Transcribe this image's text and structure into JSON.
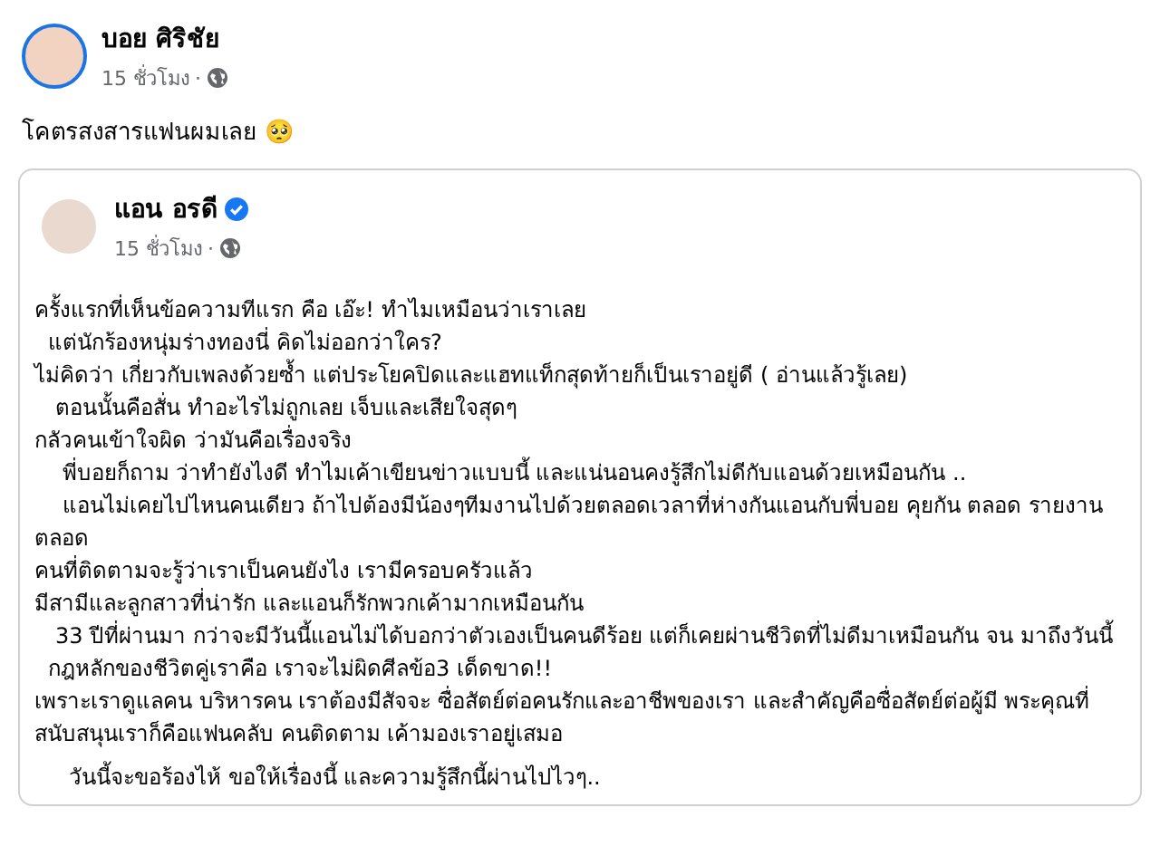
{
  "post": {
    "author": "บอย ศิริชัย",
    "time": "15 ชั่วโมง",
    "separator": "·",
    "text": "โคตรสงสารแฟนผมเลย 🥺"
  },
  "shared_post": {
    "author": "แอน อรดี",
    "verified": true,
    "time": "15 ชั่วโมง",
    "separator": "·",
    "paragraphs": [
      "ครั้งแรกที่เห็นข้อความทีแรก คือ เอ๊ะ! ทำไมเหมือนว่าเราเลย",
      "  แต่นักร้องหนุ่มร่างทองนี่ คิดไม่ออกว่าใคร?",
      "ไม่คิดว่า เกี่ยวกับเพลงด้วยซ้ำ แต่ประโยคปิดและแฮทแท็กสุดท้ายก็เป็นเราอยู่ดี ( อ่านแล้วรู้เลย)",
      "   ตอนนั้นคือสั่น ทำอะไรไม่ถูกเลย เจ็บและเสียใจสุดๆ",
      "กลัวคนเข้าใจผิด ว่ามันคือเรื่องจริง",
      "    พี่บอยก็ถาม ว่าทำยังไงดี ทำไมเค้าเขียนข่าวแบบนี้ และแน่นอนคงรู้สึกไม่ดีกับแอนด้วยเหมือนกัน ..",
      "    แอนไม่เคยไปไหนคนเดียว ถ้าไปต้องมีน้องๆทีมงานไปด้วยตลอดเวลาที่ห่างกันแอนกับพี่บอย คุยกัน ตลอด รายงานตลอด",
      "คนที่ติดตามจะรู้ว่าเราเป็นคนยังไง เรามีครอบครัวแล้ว",
      "มีสามีและลูกสาวที่น่ารัก และแอนก็รักพวกเค้ามากเหมือนกัน",
      "   33 ปีที่ผ่านมา กว่าจะมีวันนี้แอนไม่ได้บอกว่าตัวเองเป็นคนดีร้อย แต่ก็เคยผ่านชีวิตที่ไม่ดีมาเหมือนกัน จน มาถึงวันนี้",
      "  กฎหลักของชีวิตคู่เราคือ เราจะไม่ผิดศีลข้อ3 เด็ดขาด!!",
      "เพราะเราดูแลคน บริหารคน เราต้องมีสัจจะ ซื่อสัตย์ต่อคนรักและอาชีพของเรา และสำคัญคือซื่อสัตย์ต่อผู้มี พระคุณที่สนับสนุนเราก็คือแฟนคลับ คนติดตาม เค้ามองเราอยู่เสมอ",
      "     วันนี้จะขอร้องไห้ ขอให้เรื่องนี้ และความรู้สึกนี้ผ่านไปไวๆ.."
    ]
  }
}
